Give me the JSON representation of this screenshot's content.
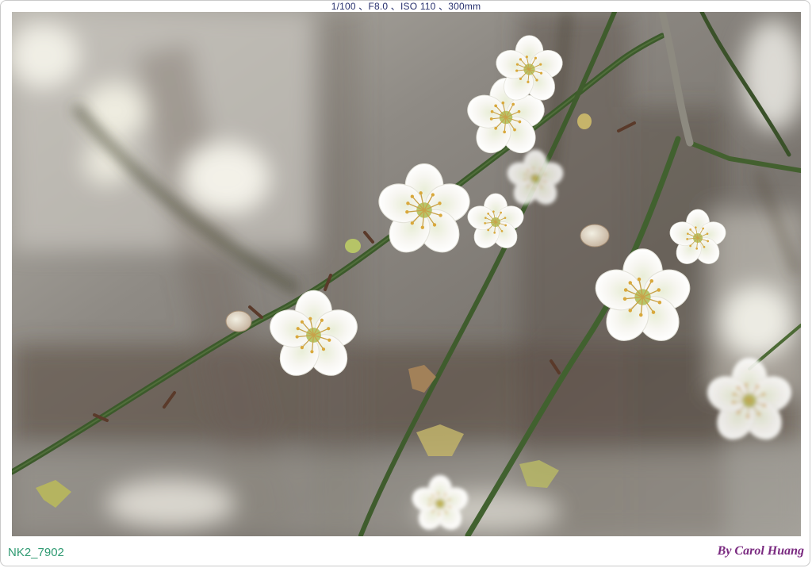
{
  "photo": {
    "exif_line": "1/100 、F8.0 、ISO 110 、300mm",
    "filename": "NK2_7902",
    "credit": "By Carol Huang",
    "subject": "white plum blossoms on thin green branches",
    "colors": {
      "background": "#7d7b78",
      "branch": "#3d5a2c",
      "petal": "#f6f5f0",
      "stamen": "#c9a43a",
      "exif_text": "#27306e",
      "filename_text": "#2f9a72",
      "credit_text": "#7a2a80"
    }
  }
}
